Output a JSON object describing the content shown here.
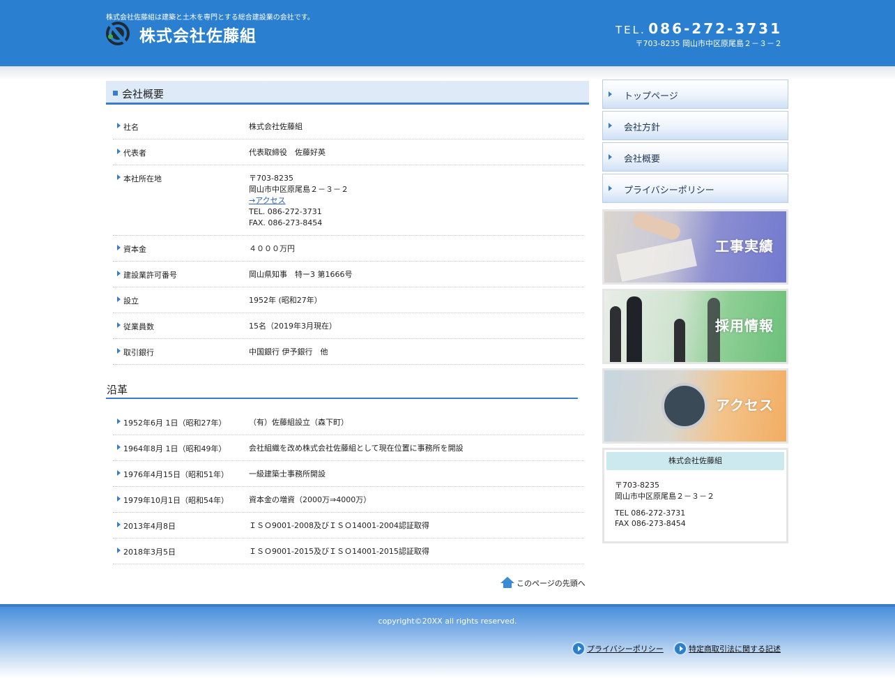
{
  "header": {
    "tagline": "株式会社佐藤組は建築と土木を専門とする総合建設業の会社です。",
    "company_name": "株式会社佐藤組",
    "tel_label": "TEL.",
    "tel_number": "086-272-3731",
    "address": "〒703-8235 岡山市中区原尾島２－３－２"
  },
  "overview": {
    "title": "会社概要",
    "rows": [
      {
        "label": "社名",
        "value": [
          "株式会社佐藤組"
        ]
      },
      {
        "label": "代表者",
        "value": [
          "代表取締役　佐藤好英"
        ]
      },
      {
        "label": "本社所在地",
        "value": [
          "〒703-8235",
          "岡山市中区原尾島２－３－２"
        ],
        "link": "→アクセス",
        "after": [
          "TEL. 086-272-3731",
          "FAX. 086-273-8454"
        ]
      },
      {
        "label": "資本金",
        "value": [
          "４０００万円"
        ]
      },
      {
        "label": "建設業許可番号",
        "value": [
          "岡山県知事　特ー3 第1666号"
        ]
      },
      {
        "label": "設立",
        "value": [
          "1952年 (昭和27年）"
        ]
      },
      {
        "label": "従業員数",
        "value": [
          "15名（2019年3月現在）"
        ]
      },
      {
        "label": "取引銀行",
        "value": [
          "中国銀行 伊予銀行　他"
        ]
      }
    ]
  },
  "history": {
    "title": "沿革",
    "rows": [
      {
        "label": "1952年6月 1日（昭和27年）",
        "value": [
          "（有）佐藤組設立（森下町）"
        ]
      },
      {
        "label": "1964年8月 1日（昭和49年）",
        "value": [
          "会社組織を改め株式会社佐藤組として現在位置に事務所を開設"
        ]
      },
      {
        "label": "1976年4月15日（昭和51年）",
        "value": [
          "一級建築士事務所開設"
        ]
      },
      {
        "label": "1979年10月1日（昭和54年）",
        "value": [
          "資本金の増資（2000万⇒4000万）"
        ]
      },
      {
        "label": "2013年4月8日",
        "value": [
          "ＩＳＯ9001-2008及びＩＳＯ14001-2004認証取得"
        ]
      },
      {
        "label": "2018年3月5日",
        "value": [
          "ＩＳＯ9001-2015及びＩＳＯ14001-2015認証取得"
        ]
      }
    ]
  },
  "page_top": "このページの先頭へ",
  "nav": {
    "items": [
      {
        "label": "トップページ"
      },
      {
        "label": "会社方針"
      },
      {
        "label": "会社概要"
      },
      {
        "label": "プライバシーポリシー"
      }
    ]
  },
  "banners": [
    {
      "label": "工事実績"
    },
    {
      "label": "採用情報"
    },
    {
      "label": "アクセス"
    }
  ],
  "sidebar_info": {
    "title": "株式会社佐藤組",
    "postal": "〒703-8235",
    "address": "岡山市中区原尾島２－３－２",
    "tel": "TEL 086-272-3731",
    "fax": "FAX 086-273-8454"
  },
  "footer": {
    "copyright": "copyright©20XX  all rights reserved.",
    "links": [
      "プライバシーポリシー",
      "特定商取引法に関する記述"
    ]
  },
  "colors": {
    "header_blue": "#2a7fd0",
    "accent_blue": "#3a7cc8",
    "section_bg": "#dfeaf8"
  }
}
